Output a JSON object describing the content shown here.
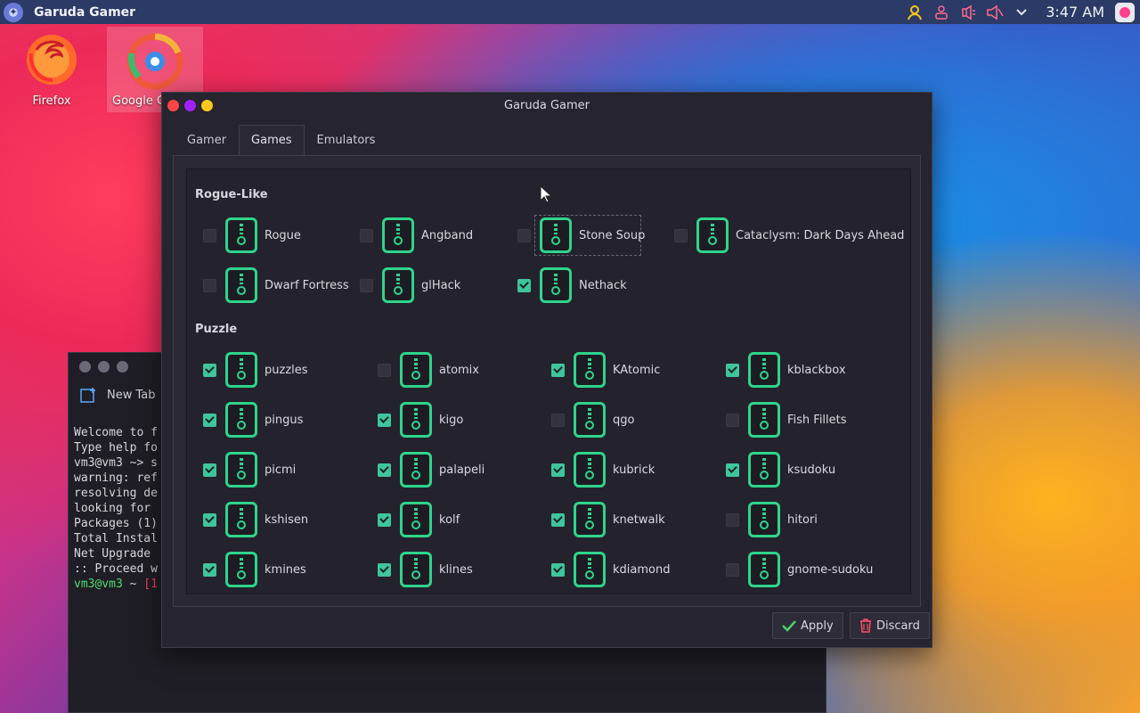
{
  "topbar": {
    "title": "Garuda Gamer",
    "clock": "3:47 AM",
    "tray_icons": [
      "user-icon",
      "user-switch-icon",
      "audio-icon",
      "volume-muted-icon",
      "chevron-down-icon"
    ]
  },
  "desktop": {
    "icons": [
      {
        "label": "Firefox",
        "icon": "firefox-icon"
      },
      {
        "label": "Google C",
        "icon": "chrome-icon"
      }
    ]
  },
  "terminal": {
    "tab_label": "New Tab",
    "lines": [
      "Welcome to f",
      "Type help fo",
      "vm3@vm3 ~> s",
      "warning: ref",
      "resolving de",
      "looking for ",
      "",
      "Packages (1)",
      "",
      "Total Instal",
      "Net Upgrade ",
      "",
      ":: Proceed w"
    ],
    "prompt_user": "vm3@vm3",
    "prompt_rest": " ~ ",
    "prompt_code": "[1"
  },
  "window": {
    "title": "Garuda Gamer",
    "tabs": [
      {
        "label": "Gamer",
        "active": false
      },
      {
        "label": "Games",
        "active": true
      },
      {
        "label": "Emulators",
        "active": false
      }
    ],
    "sections": [
      {
        "title": "Rogue-Like",
        "items": [
          {
            "name": "Rogue",
            "checked": false
          },
          {
            "name": "Angband",
            "checked": false
          },
          {
            "name": "Stone Soup",
            "checked": false,
            "focused": true
          },
          {
            "name": "Cataclysm: Dark Days Ahead",
            "checked": false
          },
          {
            "name": "Dwarf Fortress",
            "checked": false
          },
          {
            "name": "glHack",
            "checked": false
          },
          {
            "name": "Nethack",
            "checked": true
          }
        ]
      },
      {
        "title": "Puzzle",
        "items": [
          {
            "name": "puzzles",
            "checked": true
          },
          {
            "name": "atomix",
            "checked": false
          },
          {
            "name": "KAtomic",
            "checked": true
          },
          {
            "name": "kblackbox",
            "checked": true
          },
          {
            "name": "pingus",
            "checked": true
          },
          {
            "name": "kigo",
            "checked": true
          },
          {
            "name": "qgo",
            "checked": false
          },
          {
            "name": "Fish Fillets",
            "checked": false
          },
          {
            "name": "picmi",
            "checked": true
          },
          {
            "name": "palapeli",
            "checked": true
          },
          {
            "name": "kubrick",
            "checked": true
          },
          {
            "name": "ksudoku",
            "checked": true
          },
          {
            "name": "kshisen",
            "checked": true
          },
          {
            "name": "kolf",
            "checked": true
          },
          {
            "name": "knetwalk",
            "checked": true
          },
          {
            "name": "hitori",
            "checked": false
          },
          {
            "name": "kmines",
            "checked": true
          },
          {
            "name": "klines",
            "checked": true
          },
          {
            "name": "kdiamond",
            "checked": true
          },
          {
            "name": "gnome-sudoku",
            "checked": false
          }
        ]
      }
    ],
    "buttons": {
      "apply": "Apply",
      "discard": "Discard"
    }
  },
  "colors": {
    "accent_green": "#2fd48b",
    "check_green": "#3fc59c",
    "window_bg": "#26242f",
    "panel_bg": "#2b3a67"
  }
}
